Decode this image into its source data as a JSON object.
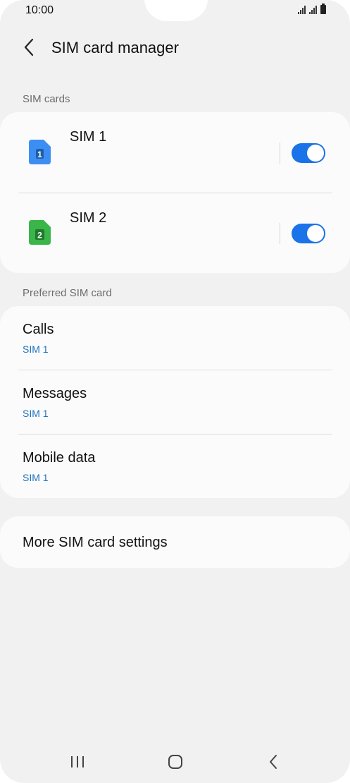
{
  "status_bar": {
    "time": "10:00"
  },
  "header": {
    "title": "SIM card manager"
  },
  "sim_section": {
    "label": "SIM cards",
    "items": [
      {
        "name": "SIM 1",
        "badge": "1",
        "color": "#3d8ef2",
        "enabled": true
      },
      {
        "name": "SIM 2",
        "badge": "2",
        "color": "#3ab54a",
        "enabled": true
      }
    ]
  },
  "preferred_section": {
    "label": "Preferred SIM card",
    "items": [
      {
        "title": "Calls",
        "value": "SIM 1"
      },
      {
        "title": "Messages",
        "value": "SIM 1"
      },
      {
        "title": "Mobile data",
        "value": "SIM 1"
      }
    ]
  },
  "more": {
    "label": "More SIM card settings"
  },
  "colors": {
    "accent": "#1a73e8",
    "link": "#1e73be",
    "background": "#f1f1f1",
    "card": "#fbfbfb"
  },
  "icons": {
    "back": "chevron-left-icon",
    "nav_recent": "recent-apps-icon",
    "nav_home": "home-icon",
    "nav_back": "back-icon"
  }
}
